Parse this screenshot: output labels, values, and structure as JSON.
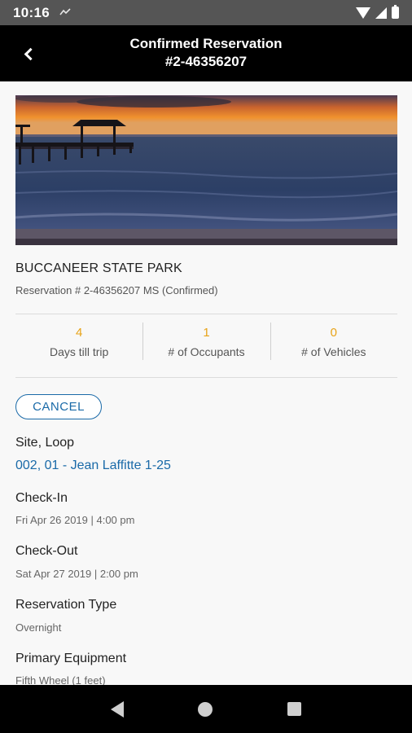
{
  "status_bar": {
    "time": "10:16",
    "icons": [
      "notification-icon",
      "wifi-icon",
      "signal-icon",
      "battery-icon"
    ]
  },
  "app_bar": {
    "title_line1": "Confirmed Reservation",
    "title_line2": "#2-46356207",
    "back_icon": "chevron-left-icon"
  },
  "reservation": {
    "park_name": "BUCCANEER STATE PARK",
    "reservation_line": "Reservation # 2-46356207 MS (Confirmed)"
  },
  "stats": [
    {
      "value": "4",
      "label": "Days till trip"
    },
    {
      "value": "1",
      "label": "# of Occupants"
    },
    {
      "value": "0",
      "label": "# of Vehicles"
    }
  ],
  "cancel_label": "CANCEL",
  "details": {
    "site_loop_label": "Site, Loop",
    "site_loop_value": "002, 01 - Jean Laffitte 1-25",
    "check_in_label": "Check-In",
    "check_in_value": "Fri Apr 26 2019 | 4:00 pm",
    "check_out_label": "Check-Out",
    "check_out_value": "Sat Apr 27 2019 | 2:00 pm",
    "res_type_label": "Reservation Type",
    "res_type_value": "Overnight",
    "equipment_label": "Primary Equipment",
    "equipment_value": "Fifth Wheel (1 feet)"
  },
  "colors": {
    "accent_orange": "#e8a317",
    "link_blue": "#1a6aa8",
    "app_bar": "#000000"
  },
  "nav_bar": {
    "icons": [
      "nav-back-icon",
      "nav-home-icon",
      "nav-recents-icon"
    ]
  }
}
